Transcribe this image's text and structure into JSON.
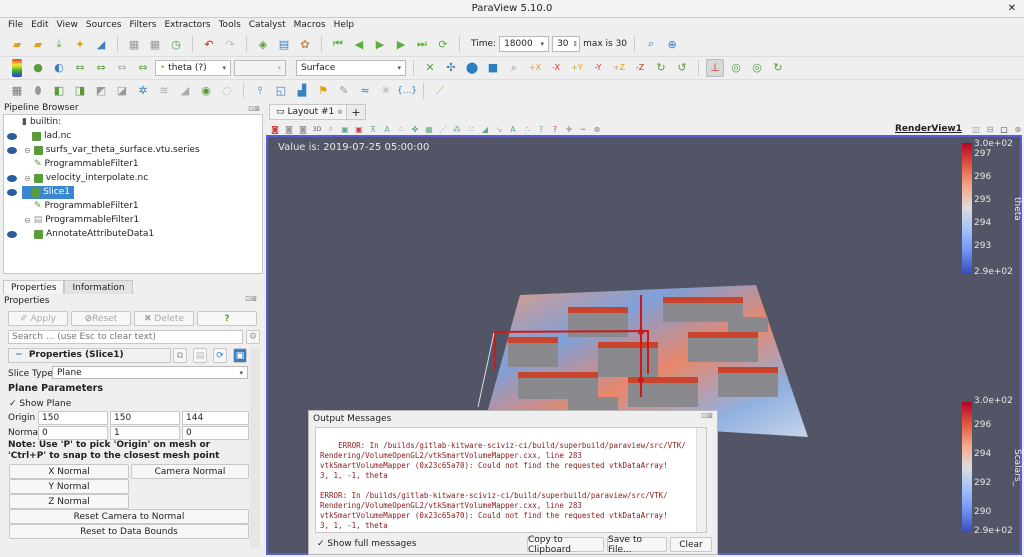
{
  "window": {
    "title": "ParaView 5.10.0",
    "close_icon": "close-icon"
  },
  "menu": [
    "File",
    "Edit",
    "View",
    "Sources",
    "Filters",
    "Extractors",
    "Tools",
    "Catalyst",
    "Macros",
    "Help"
  ],
  "toolbar1": {
    "time_label": "Time:",
    "time_value": "18000",
    "timestep_value": "30",
    "max_label": "max is 30"
  },
  "toolbar2": {
    "array_select": "theta (?)",
    "component_select": "",
    "representation_select": "Surface"
  },
  "pipeline": {
    "title": "Pipeline Browser",
    "items": [
      {
        "label": "builtin:",
        "indent": 0,
        "visible": false,
        "icon": "server-icon"
      },
      {
        "label": "lad.nc",
        "indent": 1,
        "visible": true,
        "icon": "cube-icon"
      },
      {
        "label": "surfs_var_theta_surface.vtu.series",
        "indent": 1,
        "visible": true,
        "icon": "cube-icon"
      },
      {
        "label": "ProgrammableFilter1",
        "indent": 2,
        "visible": false,
        "icon": "pencil-icon"
      },
      {
        "label": "velocity_interpolate.nc",
        "indent": 1,
        "visible": true,
        "icon": "cube-icon"
      },
      {
        "label": "Slice1",
        "indent": 2,
        "visible": true,
        "selected": true,
        "icon": "cube-icon"
      },
      {
        "label": "ProgrammableFilter1",
        "indent": 2,
        "visible": false,
        "icon": "pencil-icon"
      },
      {
        "label": "ProgrammableFilter1",
        "indent": 1,
        "visible": false,
        "icon": "table-icon"
      },
      {
        "label": "AnnotateAttributeData1",
        "indent": 2,
        "visible": true,
        "icon": "cube-icon"
      }
    ]
  },
  "properties": {
    "tabs": [
      "Properties",
      "Information"
    ],
    "title": "Properties",
    "apply": "Apply",
    "reset": "Reset",
    "delete": "Delete",
    "help": "?",
    "search_placeholder": "Search ... (use Esc to clear text)",
    "section": "Properties (Slice1)",
    "slice_type_label": "Slice Type",
    "slice_type_value": "Plane",
    "plane_params": "Plane Parameters",
    "show_plane": "Show Plane",
    "origin_label": "Origin",
    "origin": [
      "150",
      "150",
      "144"
    ],
    "normal_label": "Normal",
    "normal": [
      "0",
      "1",
      "0"
    ],
    "note": "Note: Use 'P' to pick 'Origin' on mesh or 'Ctrl+P' to snap to the closest mesh point",
    "x_normal": "X Normal",
    "camera_normal": "Camera Normal",
    "y_normal": "Y Normal",
    "z_normal": "Z Normal",
    "reset_camera": "Reset Camera to Normal",
    "reset_bounds": "Reset to Data Bounds"
  },
  "view": {
    "tab_label": "Layout #1",
    "add_tab": "+",
    "render_view_name": "RenderView1",
    "value_text": "Value is: 2019-07-25 05:00:00",
    "colorbar_top": {
      "title": "theta",
      "ticks": [
        "3.0e+02",
        "297",
        "296",
        "295",
        "294",
        "293",
        "2.9e+02"
      ]
    },
    "colorbar_bottom": {
      "title": "Scalars_",
      "ticks": [
        "3.0e+02",
        "296",
        "294",
        "292",
        "290",
        "2.9e+02"
      ]
    }
  },
  "output": {
    "title": "Output Messages",
    "text": "ERROR: In /builds/gitlab-kitware-sciviz-ci/build/superbuild/paraview/src/VTK/\nRendering/VolumeOpenGL2/vtkSmartVolumeMapper.cxx, line 283\nvtkSmartVolumeMapper (0x23c65a70): Could not find the requested vtkDataArray!\n3, 1, -1, theta\n\nERROR: In /builds/gitlab-kitware-sciviz-ci/build/superbuild/paraview/src/VTK/\nRendering/VolumeOpenGL2/vtkSmartVolumeMapper.cxx, line 283\nvtkSmartVolumeMapper (0x23c65a70): Could not find the requested vtkDataArray!\n3, 1, -1, theta",
    "show_full": "Show full messages",
    "copy": "Copy to Clipboard",
    "save": "Save to File...",
    "clear": "Clear"
  }
}
